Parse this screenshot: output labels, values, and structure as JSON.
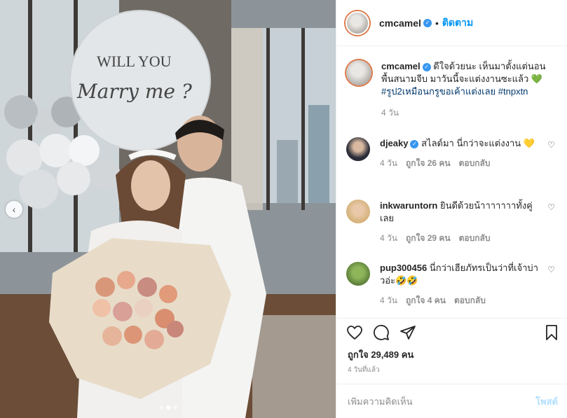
{
  "post": {
    "username": "cmcamel",
    "follow_label": "ติดตาม",
    "separator": "•",
    "balloon_line1": "WILL YOU",
    "balloon_line2": "Marry me ?"
  },
  "caption": {
    "username": "cmcamel",
    "text": "ดีใจด้วยนะ เห็นมาตั้งแต่นอนพื้นสนามจีบ มาวันนี้จะแต่งงานซะแล้ว 💚",
    "hashtags": "#รูป2เหมือนกรูขอเค้าแต่งเลย #tnpxtn",
    "time": "4 วัน"
  },
  "comments": [
    {
      "username": "djeaky",
      "text": "สไลด์มา นี่กว่าจะแต่งงาน 💛",
      "time": "4 วัน",
      "likes": "ถูกใจ 26 คน",
      "reply": "ตอบกลับ"
    },
    {
      "username": "inkwaruntorn",
      "text": "ยินดีด้วยน้าาาาาาาทั้งคู่เลย",
      "time": "4 วัน",
      "likes": "ถูกใจ 29 คน",
      "reply": "ตอบกลับ"
    },
    {
      "username": "pup300456",
      "text": "นี่กว่าเฮียภัทรเป็นว่าที่เจ้าบ่าวอ่ะ🤣🤣",
      "time": "4 วัน",
      "likes": "ถูกใจ 4 คน",
      "reply": "ตอบกลับ"
    }
  ],
  "likes_text": "ถูกใจ 29,489 คน",
  "date_text": "4 วันที่แล้ว",
  "add_comment": {
    "placeholder": "เพิ่มความคิดเห็น",
    "post_label": "โพสต์"
  },
  "icons": {
    "like": "heart-icon",
    "comment": "comment-icon",
    "share": "paper-plane-icon",
    "save": "bookmark-icon",
    "verified": "verified-badge-icon",
    "comment_like": "heart-icon",
    "carousel_prev": "chevron-left-icon"
  },
  "carousel": {
    "slide_count": 3,
    "active_index": 1
  },
  "colors": {
    "follow": "#0095f6",
    "hashtag": "#00376b",
    "verified": "#3897f0",
    "muted": "#8e8e8e"
  }
}
